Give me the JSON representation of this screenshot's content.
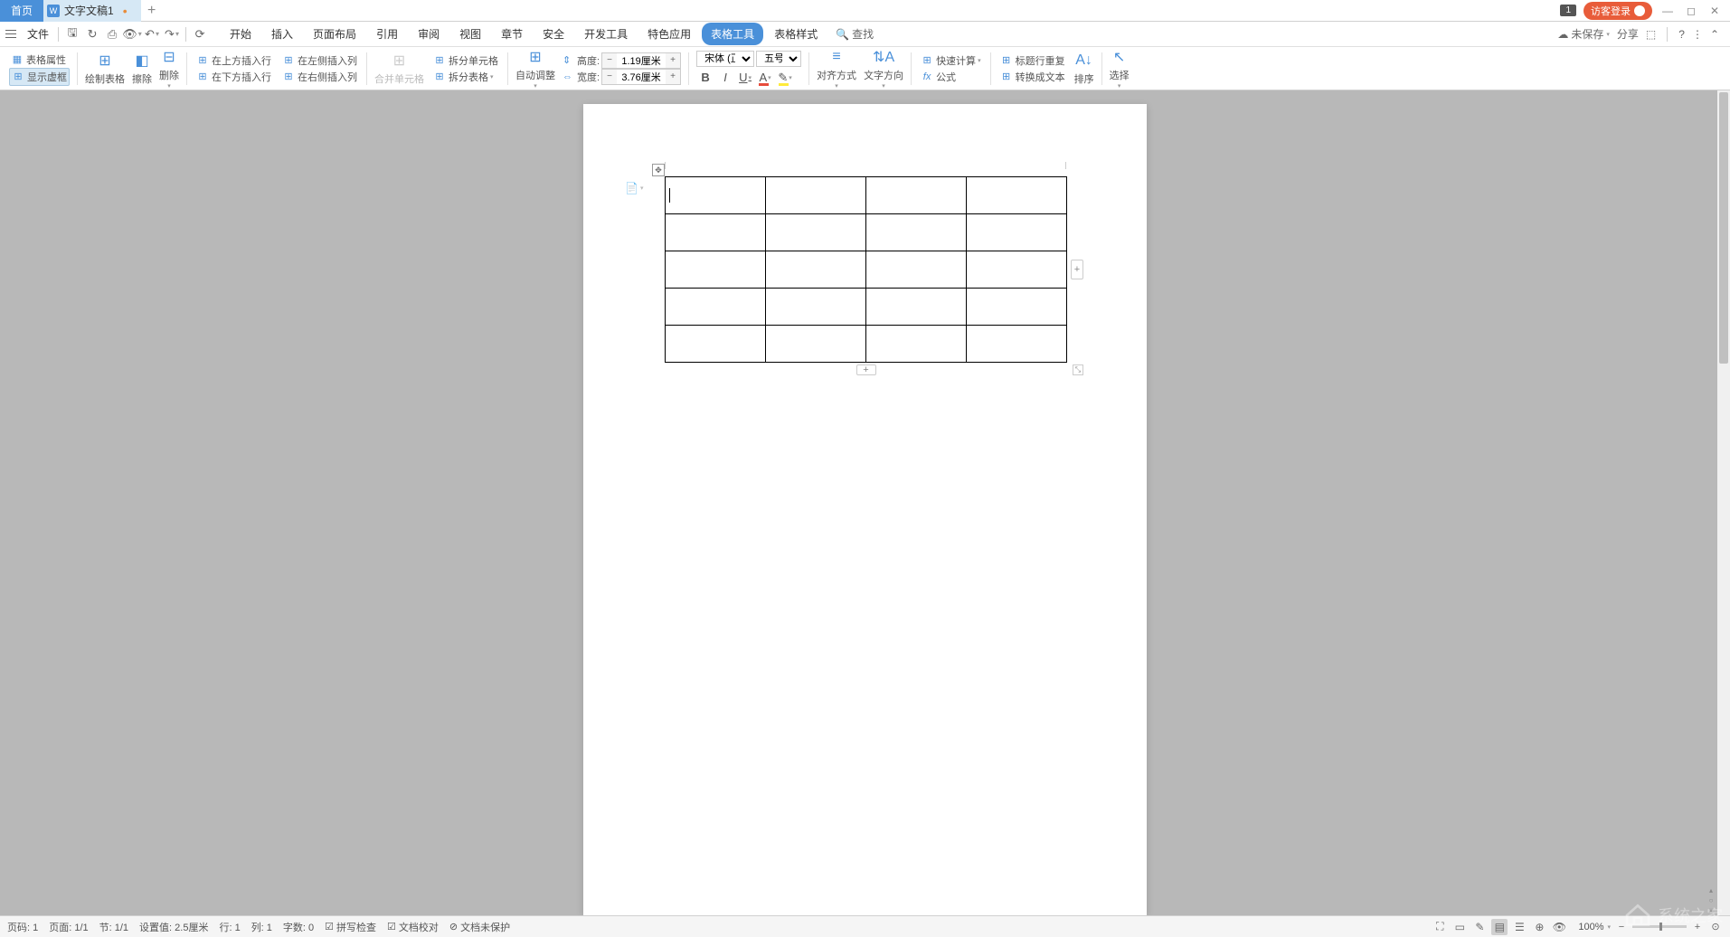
{
  "titlebar": {
    "home_tab": "首页",
    "doc_tab": "文字文稿1",
    "doc_icon": "W",
    "badge": "1",
    "login": "访客登录"
  },
  "menubar": {
    "file": "文件",
    "tabs": [
      "开始",
      "插入",
      "页面布局",
      "引用",
      "审阅",
      "视图",
      "章节",
      "安全",
      "开发工具",
      "特色应用",
      "表格工具",
      "表格样式"
    ],
    "active_tab_index": 10,
    "search": "查找",
    "unsaved": "未保存",
    "share": "分享"
  },
  "ribbon": {
    "table_props": "表格属性",
    "show_frame": "显示虚框",
    "draw_table": "绘制表格",
    "eraser": "擦除",
    "delete": "删除",
    "insert_above": "在上方插入行",
    "insert_below": "在下方插入行",
    "insert_left": "在左侧插入列",
    "insert_right": "在右侧插入列",
    "merge_cells": "合并单元格",
    "split_cells": "拆分单元格",
    "split_table": "拆分表格",
    "auto_fit": "自动调整",
    "height_label": "高度:",
    "height_value": "1.19厘米",
    "width_label": "宽度:",
    "width_value": "3.76厘米",
    "font_name": "宋体 (正文)",
    "font_size": "五号",
    "align": "对齐方式",
    "text_dir": "文字方向",
    "quick_calc": "快速计算",
    "formula": "公式",
    "fx": "fx",
    "header_repeat": "标题行重复",
    "convert_text": "转换成文本",
    "sort": "排序",
    "select": "选择"
  },
  "statusbar": {
    "page_num": "页码: 1",
    "page": "页面: 1/1",
    "section": "节: 1/1",
    "setting": "设置值: 2.5厘米",
    "row": "行: 1",
    "col": "列: 1",
    "words": "字数: 0",
    "spell_check": "拼写检查",
    "doc_check": "文档校对",
    "doc_unprotected": "文档未保护",
    "zoom": "100%"
  },
  "watermark": "系统之家"
}
